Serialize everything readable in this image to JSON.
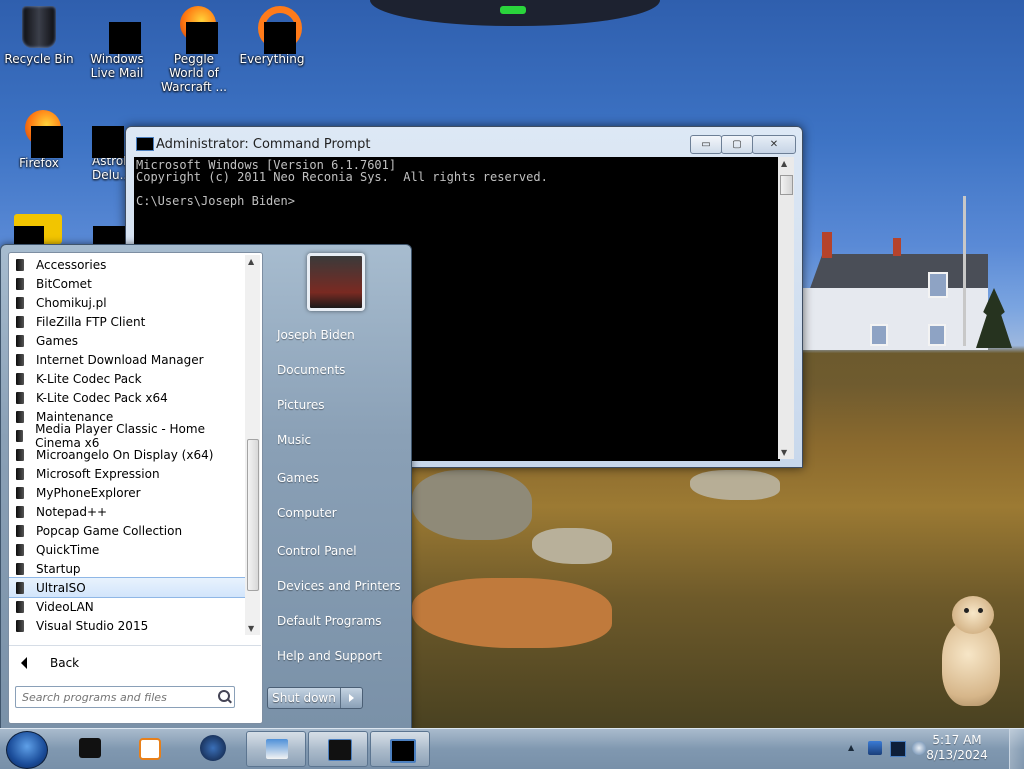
{
  "desktop": {
    "icons": [
      {
        "label": "Recycle Bin"
      },
      {
        "label": "Windows Live Mail"
      },
      {
        "label": "Peggle World of Warcraft ..."
      },
      {
        "label": "Everything"
      },
      {
        "label": "Firefox"
      },
      {
        "label": "AstroP... Delu..."
      }
    ]
  },
  "cmd_window": {
    "title": "Administrator: Command Prompt",
    "minimize_label": "▭",
    "maximize_label": "▢",
    "close_label": "✕",
    "console_text": "Microsoft Windows [Version 6.1.7601]\nCopyright (c) 2011 Neo Reconia Sys.  All rights reserved.\n\nC:\\Users\\Joseph Biden>"
  },
  "start_menu": {
    "programs": [
      {
        "label": "Accessories"
      },
      {
        "label": "BitComet"
      },
      {
        "label": "Chomikuj.pl"
      },
      {
        "label": "FileZilla FTP Client"
      },
      {
        "label": "Games"
      },
      {
        "label": "Internet Download Manager"
      },
      {
        "label": "K-Lite Codec Pack"
      },
      {
        "label": "K-Lite Codec Pack x64"
      },
      {
        "label": "Maintenance"
      },
      {
        "label": "Media Player Classic - Home Cinema x6"
      },
      {
        "label": "Microangelo On Display (x64)"
      },
      {
        "label": "Microsoft Expression"
      },
      {
        "label": "MyPhoneExplorer"
      },
      {
        "label": "Notepad++"
      },
      {
        "label": "Popcap Game Collection"
      },
      {
        "label": "QuickTime"
      },
      {
        "label": "Startup"
      },
      {
        "label": "UltraISO"
      },
      {
        "label": "VideoLAN"
      },
      {
        "label": "Visual Studio 2015"
      }
    ],
    "selected_program": "UltraISO",
    "back_label": "Back",
    "search_placeholder": "Search programs and files",
    "right_items": [
      {
        "label": "Joseph Biden"
      },
      {
        "label": "Documents"
      },
      {
        "label": "Pictures"
      },
      {
        "label": "Music"
      },
      {
        "label": "Games"
      },
      {
        "label": "Computer"
      },
      {
        "label": "Control Panel"
      },
      {
        "label": "Devices and Printers"
      },
      {
        "label": "Default Programs"
      },
      {
        "label": "Help and Support"
      }
    ],
    "shutdown_label": "Shut down"
  },
  "taskbar": {
    "clock_time": "5:17 AM",
    "clock_date": "8/13/2024",
    "tray_expand": "▲"
  }
}
